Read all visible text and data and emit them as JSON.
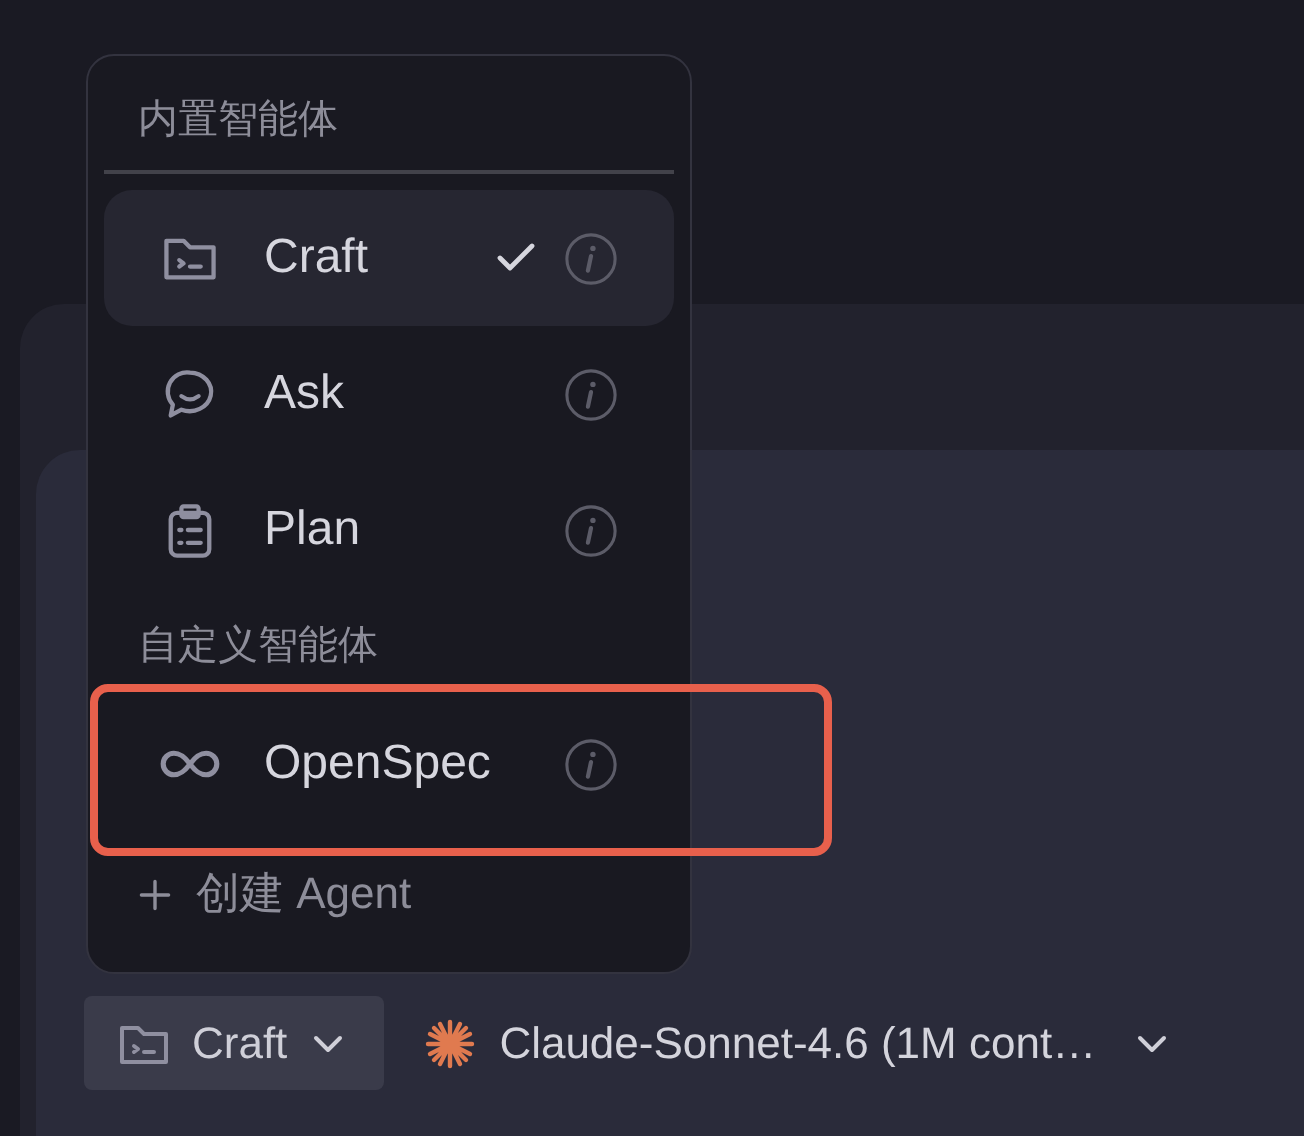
{
  "menu": {
    "sections": [
      {
        "title": "内置智能体",
        "divider": true,
        "items": [
          {
            "kind": "folder",
            "label": "Craft",
            "selected": true,
            "highlighted": false
          },
          {
            "kind": "chat",
            "label": "Ask",
            "selected": false,
            "highlighted": false
          },
          {
            "kind": "clipboard",
            "label": "Plan",
            "selected": false,
            "highlighted": false
          }
        ]
      },
      {
        "title": "自定义智能体",
        "divider": false,
        "items": [
          {
            "kind": "infinity",
            "label": "OpenSpec",
            "selected": false,
            "highlighted": true
          }
        ]
      }
    ],
    "create": {
      "label": "创建 Agent"
    }
  },
  "toolbar": {
    "agent_button": {
      "label": "Craft"
    },
    "model_selector": {
      "label": "Claude-Sonnet-4.6 (1M cont…"
    }
  }
}
